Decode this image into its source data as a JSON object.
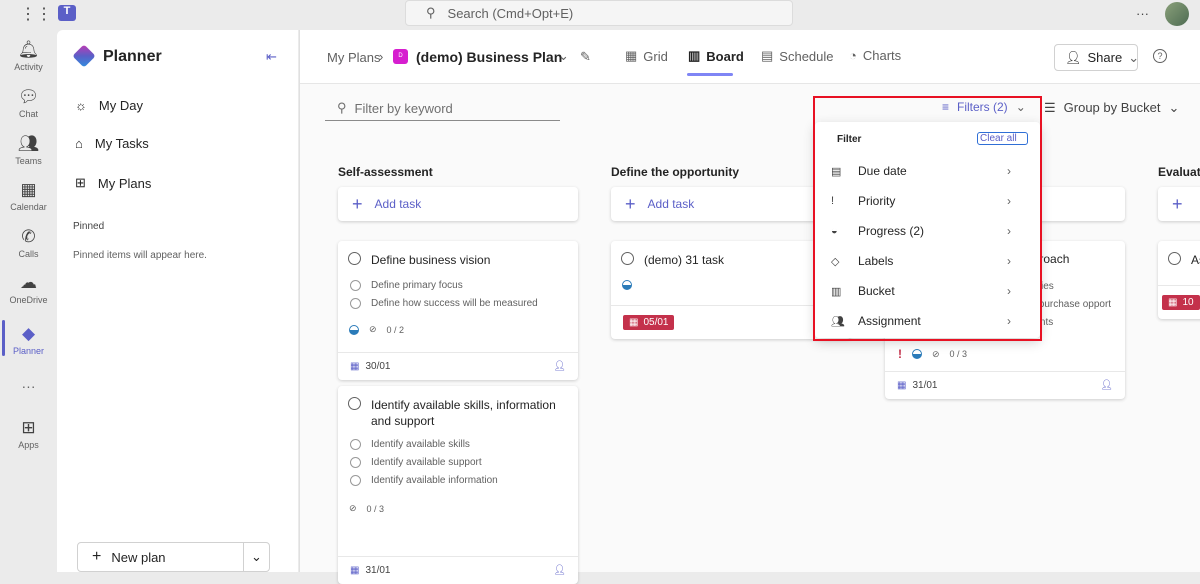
{
  "topbar": {
    "search_placeholder": "Search (Cmd+Opt+E)",
    "more": "···"
  },
  "rail": [
    {
      "label": "Activity",
      "icon": "bell-icon"
    },
    {
      "label": "Chat",
      "icon": "chat-icon"
    },
    {
      "label": "Teams",
      "icon": "teams-icon"
    },
    {
      "label": "Calendar",
      "icon": "calendar-icon"
    },
    {
      "label": "Calls",
      "icon": "phone-icon"
    },
    {
      "label": "OneDrive",
      "icon": "cloud-icon"
    },
    {
      "label": "Planner",
      "icon": "planner-icon"
    },
    {
      "label": "···"
    },
    {
      "label": "Apps",
      "icon": "plus-square-icon"
    }
  ],
  "sidebar": {
    "title": "Planner",
    "items": [
      {
        "label": "My Day"
      },
      {
        "label": "My Tasks"
      },
      {
        "label": "My Plans"
      }
    ],
    "pinned_title": "Pinned",
    "pinned_empty": "Pinned items will appear here.",
    "new_plan": "New plan"
  },
  "header": {
    "breadcrumb_root": "My Plans",
    "plan_icon_letter": "D",
    "plan_name": "(demo) Business Plan",
    "tabs": [
      {
        "label": "Grid"
      },
      {
        "label": "Board"
      },
      {
        "label": "Schedule"
      },
      {
        "label": "Charts"
      }
    ],
    "share": "Share"
  },
  "toolbar": {
    "filter_placeholder": "Filter by keyword",
    "filters": "Filters (2)",
    "group_by": "Group by Bucket"
  },
  "filter_menu": {
    "title": "Filter",
    "clear_all": "Clear all",
    "items": [
      {
        "label": "Due date"
      },
      {
        "label": "Priority"
      },
      {
        "label": "Progress (2)"
      },
      {
        "label": "Labels"
      },
      {
        "label": "Bucket"
      },
      {
        "label": "Assignment"
      }
    ]
  },
  "board": {
    "add_task": "Add task",
    "columns": [
      {
        "title": "Self-assessment",
        "cards": [
          {
            "title": "Define business vision",
            "checklist": [
              "Define primary focus",
              "Define how success will be measured"
            ],
            "checks": "0 / 2",
            "due": "30/01"
          },
          {
            "title": "Identify available skills, information and support",
            "checklist": [
              "Identify available skills",
              "Identify available support",
              "Identify available information"
            ],
            "checks": "0 / 3",
            "due": "31/01"
          }
        ]
      },
      {
        "title": "Define the opportunity",
        "cards": [
          {
            "title": "(demo) 31 task",
            "due": "05/01"
          }
        ]
      },
      {
        "title": "",
        "cards": [
          {
            "title_fragment": "pproach",
            "checklist_fragments": [
              "bilities",
              "ss purchase opport",
              "ments"
            ],
            "checks": "0 / 3",
            "due": "31/01",
            "priority": "!"
          }
        ]
      },
      {
        "title": "Evaluate",
        "cards": [
          {
            "title_fragment": "As",
            "due_fragment": "10"
          }
        ]
      }
    ]
  }
}
